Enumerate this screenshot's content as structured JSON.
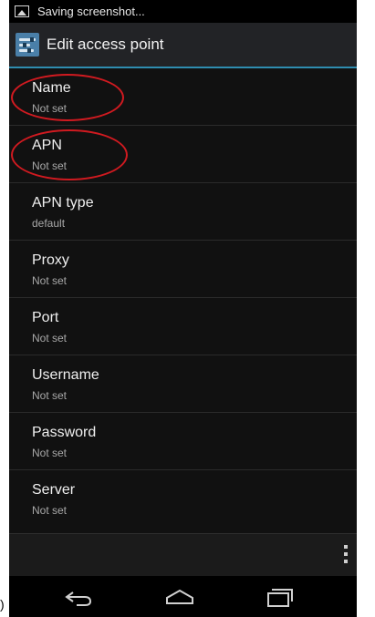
{
  "status_bar": {
    "text": "Saving screenshot...",
    "icon": "image-icon"
  },
  "action_bar": {
    "title": "Edit access point",
    "icon": "settings-sliders-icon"
  },
  "settings": [
    {
      "label": "Name",
      "value": "Not set",
      "highlighted": true
    },
    {
      "label": "APN",
      "value": "Not set",
      "highlighted": true
    },
    {
      "label": "APN type",
      "value": "default",
      "highlighted": false
    },
    {
      "label": "Proxy",
      "value": "Not set",
      "highlighted": false
    },
    {
      "label": "Port",
      "value": "Not set",
      "highlighted": false
    },
    {
      "label": "Username",
      "value": "Not set",
      "highlighted": false
    },
    {
      "label": "Password",
      "value": "Not set",
      "highlighted": false
    },
    {
      "label": "Server",
      "value": "Not set",
      "highlighted": false
    }
  ],
  "bottom_bar": {
    "overflow_icon": "overflow-menu-icon"
  },
  "nav_bar": {
    "back_icon": "back-icon",
    "home_icon": "home-icon",
    "recent_icon": "recent-apps-icon"
  },
  "outside_mark": ")",
  "colors": {
    "accent": "#2f8db0",
    "highlight": "#d01a20",
    "background": "#111111"
  }
}
